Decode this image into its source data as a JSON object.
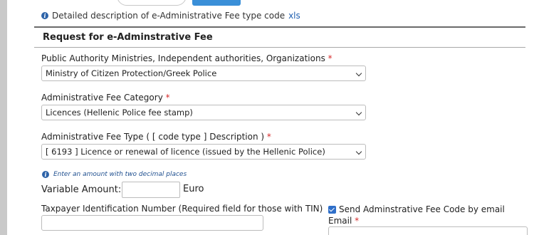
{
  "info": {
    "description_text": "Detailed description of e-Administrative Fee type code",
    "xls_link": "xls"
  },
  "section": {
    "title": "Request for e-Adminstrative Fee"
  },
  "fields": {
    "authority": {
      "label": "Public Authority Ministries, Independent authorities, Organizations",
      "required_mark": "*",
      "value": "Ministry of Citizen Protection/Greek Police"
    },
    "category": {
      "label": "Administrative Fee Category",
      "required_mark": "*",
      "value": "Licences (Hellenic Police fee stamp)"
    },
    "fee_type": {
      "label": "Administrative Fee Type ( [ code type ] Description )",
      "required_mark": "*",
      "value": "[ 6193 ] Licence or renewal of licence (issued by the Hellenic Police)"
    },
    "amount": {
      "hint": "Enter an amount with two decimal places",
      "label": "Variable Amount:",
      "value": "",
      "currency": "Euro"
    },
    "tin": {
      "label": "Taxpayer Identification Number (Required field for those with TIN)",
      "value": ""
    },
    "send_email": {
      "label": "Send Adminstrative Fee Code by email",
      "checked": true
    },
    "email": {
      "label": "Email",
      "required_mark": "*",
      "value": ""
    }
  },
  "colors": {
    "accent": "#3a8fd8",
    "required": "#d62b2b",
    "link": "#1f5fb0",
    "checkbox": "#2f6fc9"
  },
  "icons": [
    "info-icon",
    "chevron-down-icon",
    "checkbox-checked-icon"
  ]
}
